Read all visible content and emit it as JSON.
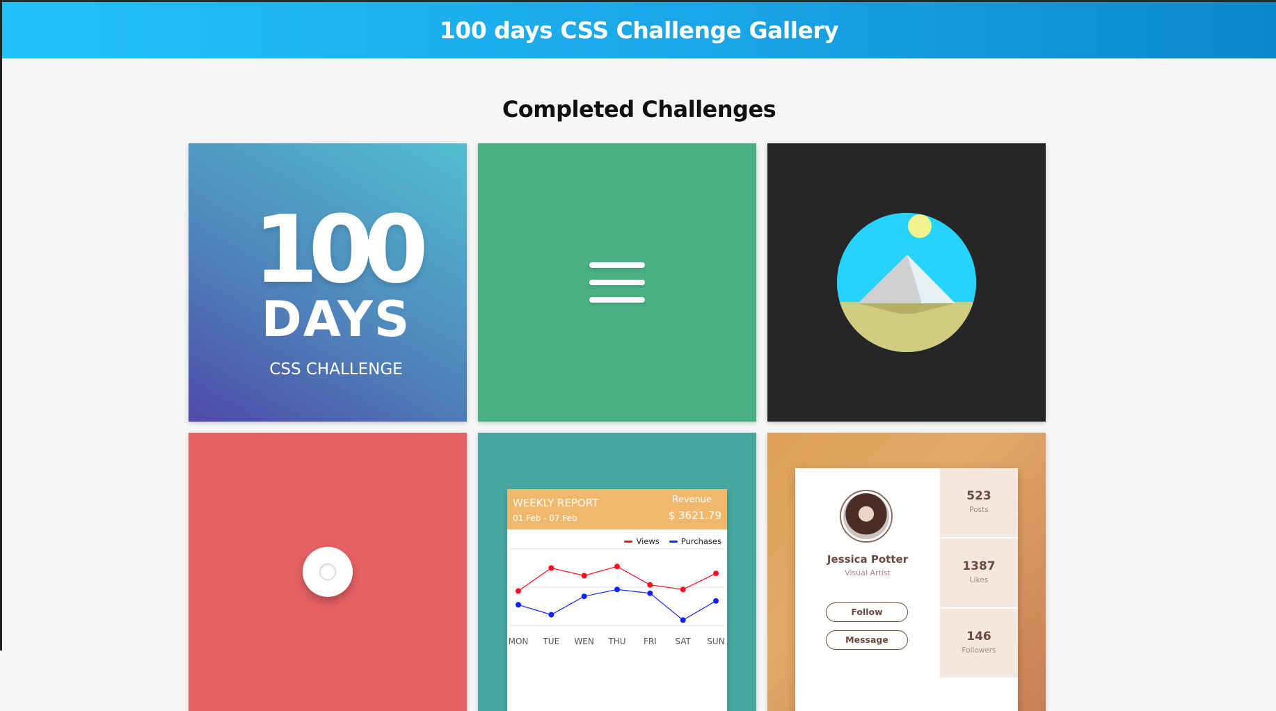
{
  "header": {
    "title": "100 days CSS Challenge Gallery"
  },
  "section": {
    "title": "Completed Challenges"
  },
  "cards": {
    "c1": {
      "number": "100",
      "days": "DAYS",
      "subtitle": "CSS CHALLENGE"
    },
    "c5": {
      "report_title": "WEEKLY REPORT",
      "dates": "01.Feb - 07.Feb",
      "revenue_label": "Revenue",
      "revenue_value": "$ 3621.79",
      "legend": {
        "views": "Views",
        "purchases": "Purchases"
      }
    },
    "c6": {
      "name": "Jessica Potter",
      "role": "Visual Artist",
      "follow": "Follow",
      "message": "Message",
      "stats": [
        {
          "value": "523",
          "label": "Posts"
        },
        {
          "value": "1387",
          "label": "Likes"
        },
        {
          "value": "146",
          "label": "Followers"
        }
      ]
    }
  },
  "chart_data": {
    "type": "line",
    "title": "WEEKLY REPORT",
    "categories": [
      "MON",
      "TUE",
      "WEN",
      "THU",
      "FRI",
      "SAT",
      "SUN"
    ],
    "series": [
      {
        "name": "Views",
        "color": "#ff0a1e",
        "values": [
          45,
          75,
          65,
          77,
          53,
          47,
          68
        ]
      },
      {
        "name": "Purchases",
        "color": "#1024ff",
        "values": [
          27,
          14,
          38,
          47,
          42,
          7,
          32
        ]
      }
    ],
    "ylim": [
      0,
      100
    ],
    "grid": true,
    "legend": "top-right"
  },
  "colors": {
    "header_gradient_start": "#22c1fa",
    "header_gradient_end": "#0b88cc",
    "card2": "#48b084",
    "card3": "#262626",
    "card4": "#e56164",
    "card5": "#48a8a0",
    "report_header": "#f1b86c"
  }
}
